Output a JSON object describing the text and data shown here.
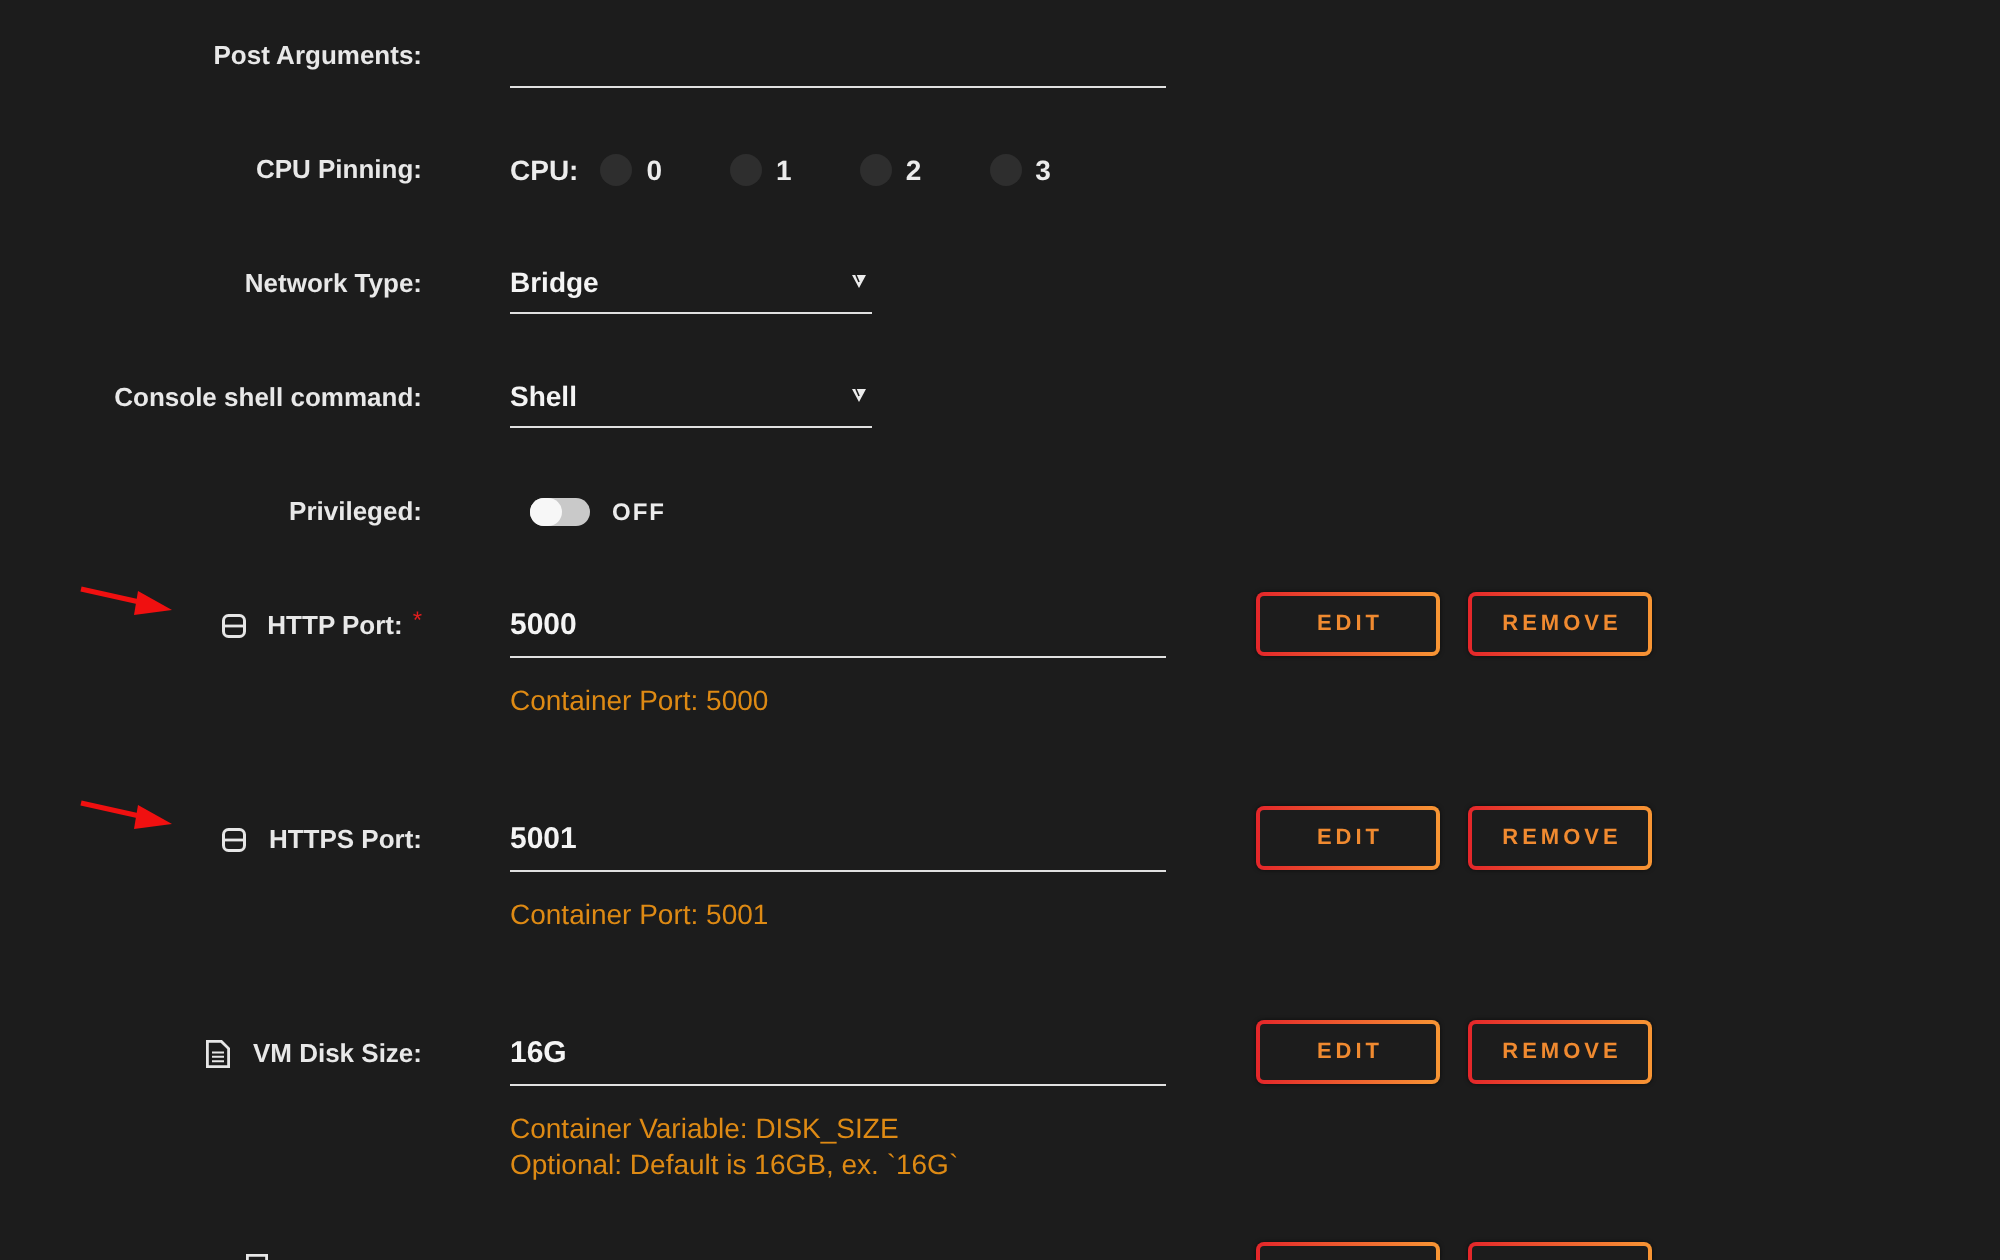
{
  "settings": [
    {
      "kind": "text",
      "label": "Post Arguments:"
    },
    {
      "kind": "cpu",
      "label": "CPU Pinning:",
      "prefix": "CPU:",
      "cpus": [
        {
          "label": "0",
          "checked": false
        },
        {
          "label": "1",
          "checked": false
        },
        {
          "label": "2",
          "checked": false
        },
        {
          "label": "3",
          "checked": false
        }
      ]
    },
    {
      "kind": "select",
      "label": "Network Type:",
      "value": "Bridge"
    },
    {
      "kind": "select",
      "label": "Console shell command:",
      "value": "Shell"
    },
    {
      "kind": "toggle",
      "label": "Privileged:",
      "on": false,
      "state_text": "OFF"
    }
  ],
  "config_items": [
    {
      "kind": "port",
      "arrow": true,
      "label": "HTTP Port:",
      "required_mark": "*",
      "value": "5000",
      "hints": [
        "Container Port: 5000"
      ],
      "buttons": [
        "EDIT",
        "REMOVE"
      ]
    },
    {
      "kind": "port",
      "arrow": true,
      "label": "HTTPS Port:",
      "value": "5001",
      "hints": [
        "Container Port: 5001"
      ],
      "buttons": [
        "EDIT",
        "REMOVE"
      ]
    },
    {
      "kind": "variable",
      "arrow": false,
      "label": "VM Disk Size:",
      "value": "16G",
      "hints": [
        "Container Variable: DISK_SIZE",
        "Optional: Default is 16GB, ex. `16G`"
      ],
      "buttons": [
        "EDIT",
        "REMOVE"
      ]
    },
    {
      "kind": "cut_off"
    }
  ]
}
